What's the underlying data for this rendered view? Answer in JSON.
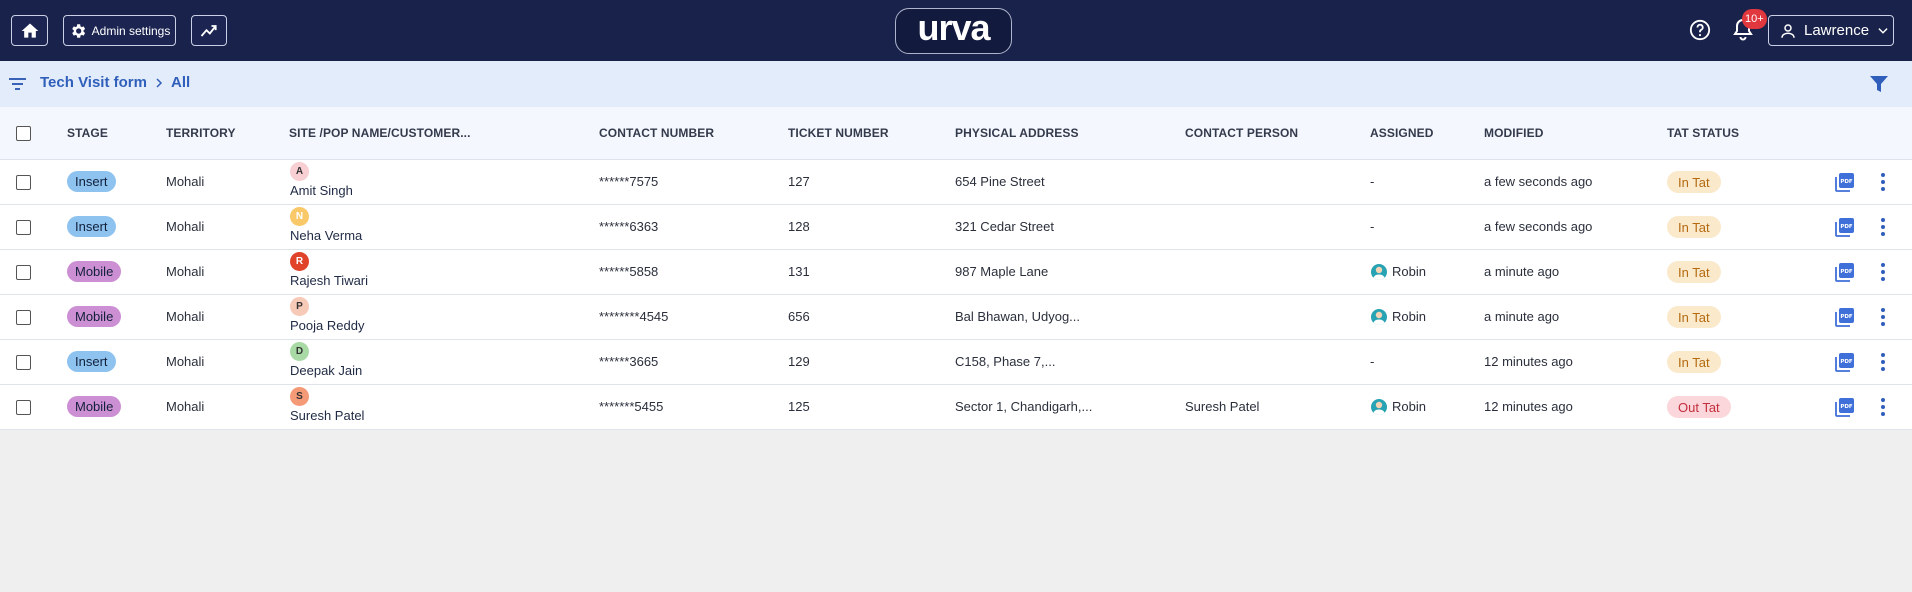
{
  "topbar": {
    "admin_label": "Admin settings",
    "logo_text": "urva",
    "notification_badge": "10+",
    "user_name": "Lawrence",
    "bg_color": "#19224a"
  },
  "breadcrumb": {
    "form": "Tech Visit form",
    "view": "All"
  },
  "table": {
    "headers": {
      "stage": "STAGE",
      "territory": "TERRITORY",
      "site": "SITE /POP NAME/CUSTOMER...",
      "contact": "CONTACT NUMBER",
      "ticket": "TICKET NUMBER",
      "address": "PHYSICAL ADDRESS",
      "person": "CONTACT PERSON",
      "assigned": "ASSIGNED",
      "modified": "MODIFIED",
      "tat": "TAT STATUS"
    },
    "rows": [
      {
        "stage": "Insert",
        "stage_type": "insert",
        "territory": "Mohali",
        "initial": "A",
        "avatar_bg": "#f8cfd2",
        "avatar_fg": "#333",
        "site": "Amit Singh",
        "contact": "******7575",
        "ticket": "127",
        "address": "654 Pine Street",
        "person": "",
        "assigned": "-",
        "modified": "a few seconds ago",
        "tat": "In Tat",
        "tat_type": "in"
      },
      {
        "stage": "Insert",
        "stage_type": "insert",
        "territory": "Mohali",
        "initial": "N",
        "avatar_bg": "#f9c868",
        "avatar_fg": "#fff",
        "site": "Neha Verma",
        "contact": "******6363",
        "ticket": "128",
        "address": "321 Cedar Street",
        "person": "",
        "assigned": "-",
        "modified": "a few seconds ago",
        "tat": "In Tat",
        "tat_type": "in"
      },
      {
        "stage": "Mobile",
        "stage_type": "mobile",
        "territory": "Mohali",
        "initial": "R",
        "avatar_bg": "#e0422a",
        "avatar_fg": "#fff",
        "site": "Rajesh Tiwari",
        "contact": "******5858",
        "ticket": "131",
        "address": "987 Maple Lane",
        "person": "",
        "assigned": "Robin",
        "modified": "a minute ago",
        "tat": "In Tat",
        "tat_type": "in"
      },
      {
        "stage": "Mobile",
        "stage_type": "mobile",
        "territory": "Mohali",
        "initial": "P",
        "avatar_bg": "#f7c9b7",
        "avatar_fg": "#333",
        "site": "Pooja Reddy",
        "contact": "********4545",
        "ticket": "656",
        "address": "Bal Bhawan, Udyog...",
        "person": "",
        "assigned": "Robin",
        "modified": "a minute ago",
        "tat": "In Tat",
        "tat_type": "in"
      },
      {
        "stage": "Insert",
        "stage_type": "insert",
        "territory": "Mohali",
        "initial": "D",
        "avatar_bg": "#a9d9a5",
        "avatar_fg": "#333",
        "site": "Deepak Jain",
        "contact": "******3665",
        "ticket": "129",
        "address": "C158, Phase 7,...",
        "person": "",
        "assigned": "-",
        "modified": "12 minutes ago",
        "tat": "In Tat",
        "tat_type": "in"
      },
      {
        "stage": "Mobile",
        "stage_type": "mobile",
        "territory": "Mohali",
        "initial": "S",
        "avatar_bg": "#f59a77",
        "avatar_fg": "#333",
        "site": "Suresh Patel",
        "contact": "*******5455",
        "ticket": "125",
        "address": "Sector 1, Chandigarh,...",
        "person": "Suresh Patel",
        "assigned": "Robin",
        "modified": "12 minutes ago",
        "tat": "Out Tat",
        "tat_type": "out"
      }
    ]
  }
}
